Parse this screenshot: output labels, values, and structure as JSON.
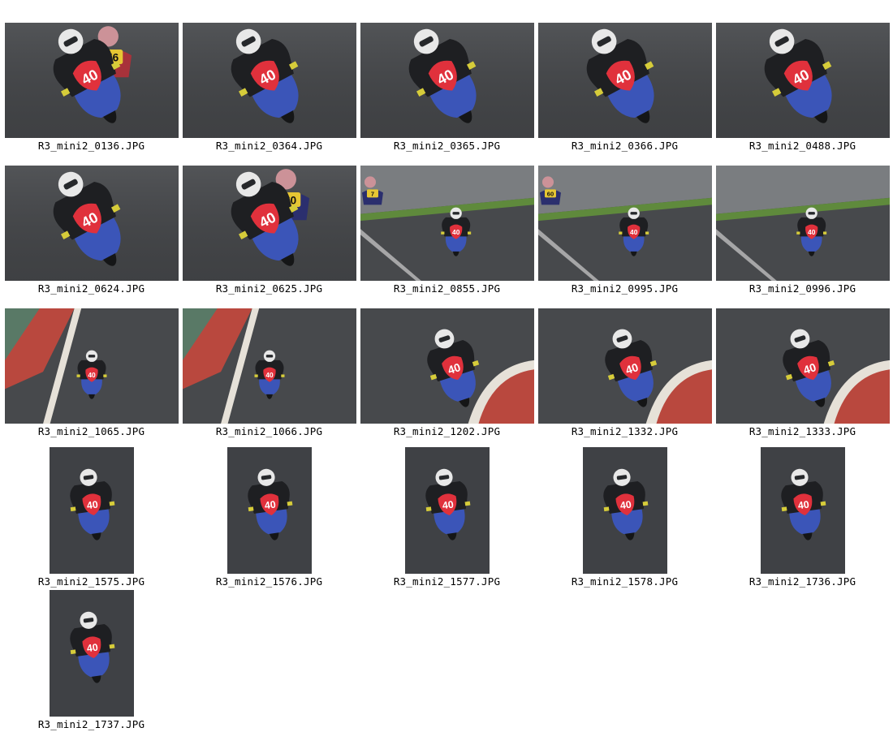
{
  "gallery": {
    "items": [
      {
        "file": "R3_mini2_0136.JPG",
        "orientation": "landscape",
        "scene": "close",
        "number": "40",
        "extra_bike": "56"
      },
      {
        "file": "R3_mini2_0364.JPG",
        "orientation": "landscape",
        "scene": "close",
        "number": "40"
      },
      {
        "file": "R3_mini2_0365.JPG",
        "orientation": "landscape",
        "scene": "close",
        "number": "40"
      },
      {
        "file": "R3_mini2_0366.JPG",
        "orientation": "landscape",
        "scene": "close",
        "number": "40"
      },
      {
        "file": "R3_mini2_0488.JPG",
        "orientation": "landscape",
        "scene": "close",
        "number": "40"
      },
      {
        "file": "R3_mini2_0624.JPG",
        "orientation": "landscape",
        "scene": "close",
        "number": "40"
      },
      {
        "file": "R3_mini2_0625.JPG",
        "orientation": "landscape",
        "scene": "close",
        "number": "40",
        "extra_bike": "60"
      },
      {
        "file": "R3_mini2_0855.JPG",
        "orientation": "landscape",
        "scene": "far",
        "number": "40",
        "extra_bike": "7"
      },
      {
        "file": "R3_mini2_0995.JPG",
        "orientation": "landscape",
        "scene": "far",
        "number": "40",
        "extra_bike": "60"
      },
      {
        "file": "R3_mini2_0996.JPG",
        "orientation": "landscape",
        "scene": "far",
        "number": "40"
      },
      {
        "file": "R3_mini2_1065.JPG",
        "orientation": "landscape",
        "scene": "far-kerb",
        "number": "40"
      },
      {
        "file": "R3_mini2_1066.JPG",
        "orientation": "landscape",
        "scene": "far-kerb",
        "number": "40"
      },
      {
        "file": "R3_mini2_1202.JPG",
        "orientation": "landscape",
        "scene": "mid-kerb",
        "number": "40"
      },
      {
        "file": "R3_mini2_1332.JPG",
        "orientation": "landscape",
        "scene": "mid-kerb",
        "number": "40"
      },
      {
        "file": "R3_mini2_1333.JPG",
        "orientation": "landscape",
        "scene": "mid-kerb",
        "number": "40"
      },
      {
        "file": "R3_mini2_1575.JPG",
        "orientation": "portrait",
        "scene": "portrait",
        "number": "40"
      },
      {
        "file": "R3_mini2_1576.JPG",
        "orientation": "portrait",
        "scene": "portrait",
        "number": "40"
      },
      {
        "file": "R3_mini2_1577.JPG",
        "orientation": "portrait",
        "scene": "portrait",
        "number": "40"
      },
      {
        "file": "R3_mini2_1578.JPG",
        "orientation": "portrait",
        "scene": "portrait",
        "number": "40"
      },
      {
        "file": "R3_mini2_1736.JPG",
        "orientation": "portrait",
        "scene": "portrait",
        "number": "40"
      },
      {
        "file": "R3_mini2_1737.JPG",
        "orientation": "portrait",
        "scene": "portrait",
        "number": "40"
      }
    ]
  },
  "colors": {
    "page_background": "#ffffff",
    "caption_text": "#000000",
    "track": "#47494c",
    "grass": "#5f8a3c",
    "bike_body": "#3b55b8",
    "number_plate": "#e0313c",
    "helmet": "#e8e8e8",
    "leathers": "#1e1f22",
    "kerb_red": "#b9483e",
    "kerb_white": "#e6e1d8"
  }
}
